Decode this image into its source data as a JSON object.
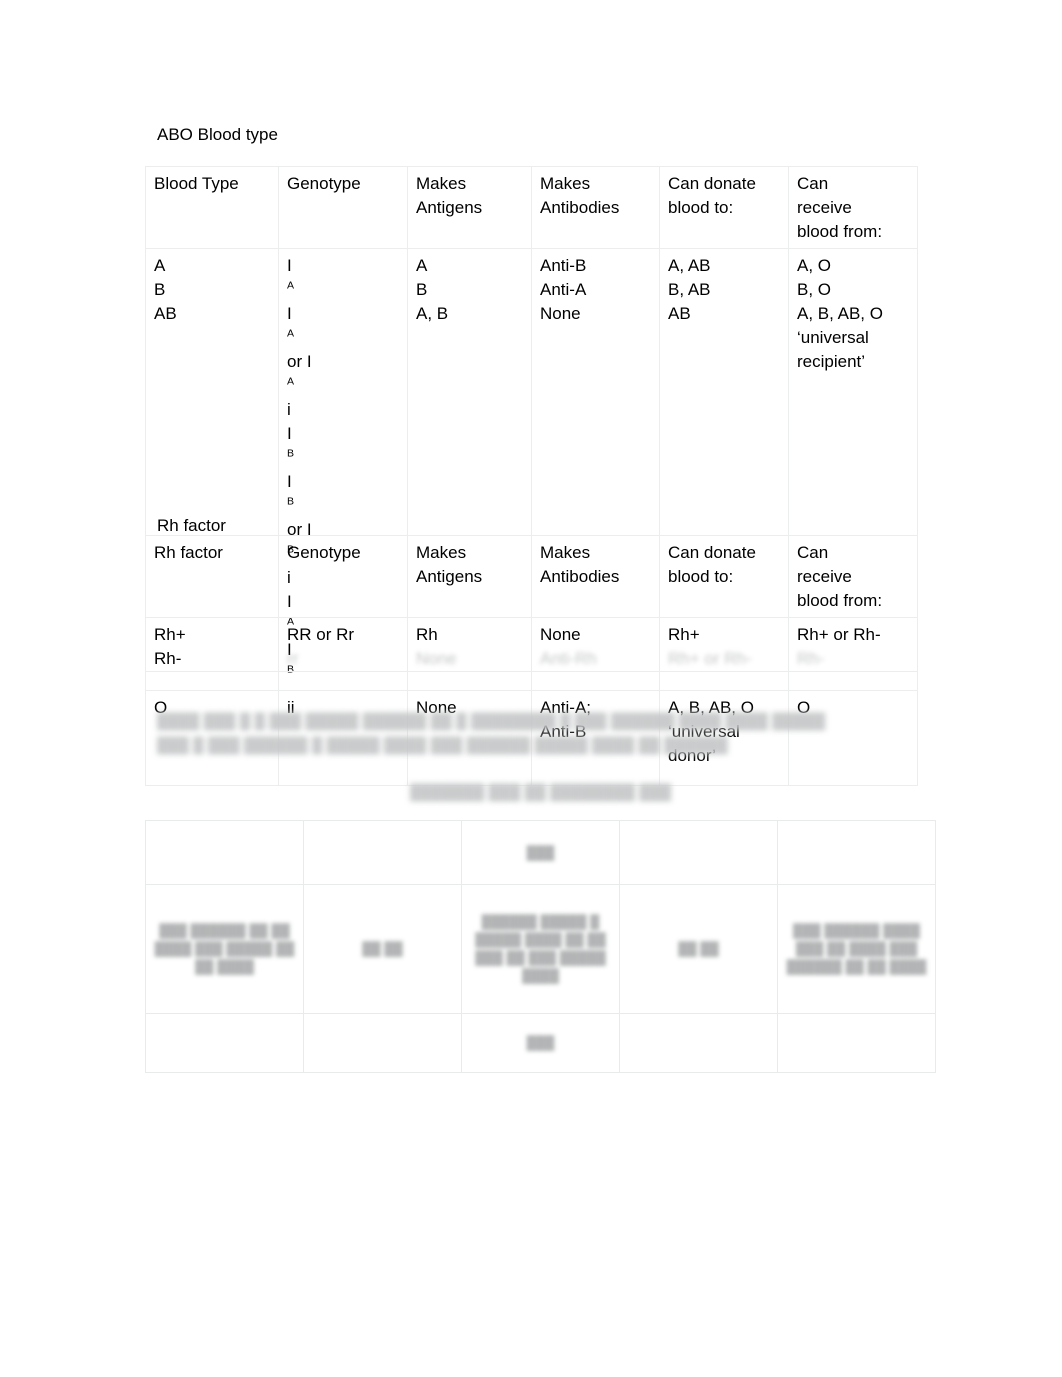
{
  "document": {
    "abo_section": {
      "heading": "ABO Blood type",
      "table": {
        "headers": [
          "Blood Type",
          "Genotype",
          "Makes Antigens",
          "Makes Antibodies",
          "Can donate blood to:",
          "Can receive blood from:"
        ],
        "header_lines": {
          "col1": [
            "Blood Type"
          ],
          "col2": [
            "Genotype"
          ],
          "col3": [
            "Makes",
            "Antigens"
          ],
          "col4": [
            "Makes",
            "Antibodies"
          ],
          "col5": [
            "Can donate",
            "blood to:"
          ],
          "col6": [
            "Can",
            "receive",
            "blood from:"
          ]
        },
        "body_block": {
          "blood_type": [
            "A",
            "B",
            "AB"
          ],
          "genotype": [
            {
              "plain": "IAIA or IAi",
              "parts": [
                "I",
                "A",
                "I",
                "A",
                " or I",
                "A",
                "i"
              ]
            },
            {
              "plain": "IBIB or IB i",
              "parts": [
                "I",
                "B",
                "I",
                "B",
                " or I",
                "B",
                " i"
              ]
            },
            {
              "plain": "IA IB",
              "parts": [
                "I",
                "A",
                " I",
                "B"
              ]
            }
          ],
          "genotype_display": {
            "row1": {
              "b1": "I",
              "s1": "A",
              "b2": "I",
              "s2": "A",
              "b3": " or I",
              "s3": "A",
              "b4": "i"
            },
            "row2": {
              "b1": "I",
              "s1": "B",
              "b2": "I",
              "s2": "B",
              "b3": " or I",
              "s3": "B",
              "b4": " i"
            },
            "row3": {
              "b1": "I",
              "s1": "A",
              "b2": " I",
              "s2": "B"
            }
          },
          "makes_antigens": [
            "A",
            "B",
            "A, B"
          ],
          "makes_antibodies": [
            "Anti-B",
            "Anti-A",
            "None"
          ],
          "can_donate": [
            "A, AB",
            "B, AB",
            "AB"
          ],
          "can_receive": [
            "A, O",
            "B, O",
            "A, B, AB, O",
            "‘universal",
            "recipient’"
          ]
        },
        "row_o": {
          "blood_type": "O",
          "genotype": "ii",
          "makes_antigens": "None",
          "makes_antibodies": [
            "Anti-A;",
            "Anti-B"
          ],
          "can_donate": [
            "A, B, AB, O",
            "‘universal",
            "donor’"
          ],
          "can_receive": "O"
        }
      }
    },
    "rh_section": {
      "heading": "Rh factor",
      "table": {
        "header_lines": {
          "col1": [
            "Rh factor"
          ],
          "col2": [
            "Genotype"
          ],
          "col3": [
            "Makes",
            "Antigens"
          ],
          "col4": [
            "Makes",
            "Antibodies"
          ],
          "col5": [
            "Can donate",
            "blood to:"
          ],
          "col6": [
            "Can",
            "receive",
            "blood from:"
          ]
        },
        "row_rh_positive": {
          "rh_factor": "Rh+",
          "genotype": "RR or Rr",
          "makes_antigens": "Rh",
          "makes_antibodies": "None",
          "can_donate": "Rh+",
          "can_receive": "Rh+ or Rh-"
        },
        "row_rh_negative": {
          "rh_factor": "Rh-",
          "genotype": "rr",
          "makes_antigens": "None",
          "makes_antibodies": "Anti-Rh",
          "can_donate": "Rh+ or Rh-",
          "can_receive": "Rh-"
        }
      }
    },
    "obscured": {
      "paragraph_line1": "████ ███ █ █ ███ █████ ██████ ██ █ ████████ █ ███ ██████ ████ ████ █████",
      "paragraph_line2": "███ █ ███ ██████ █ █████ ████ ███ ██████ █████ ████ ██ ██████",
      "subheading": "███████ ███ ██ ████████ ███",
      "table": {
        "row_top": [
          "",
          "",
          "███",
          "",
          ""
        ],
        "row_mid": [
          "███ ██████ ██ ██ ████ ███ █████ ██ ██ ████",
          "██ ██",
          "██████ █████ █ █████ ████ ██ ██ ███ ██ ███ █████ ████",
          "██ ██",
          "███ ██████ ████ ███ ██ ████ ███ ██████ ██ ██ ████"
        ],
        "row_bot": [
          "",
          "",
          "███",
          "",
          ""
        ]
      }
    }
  }
}
